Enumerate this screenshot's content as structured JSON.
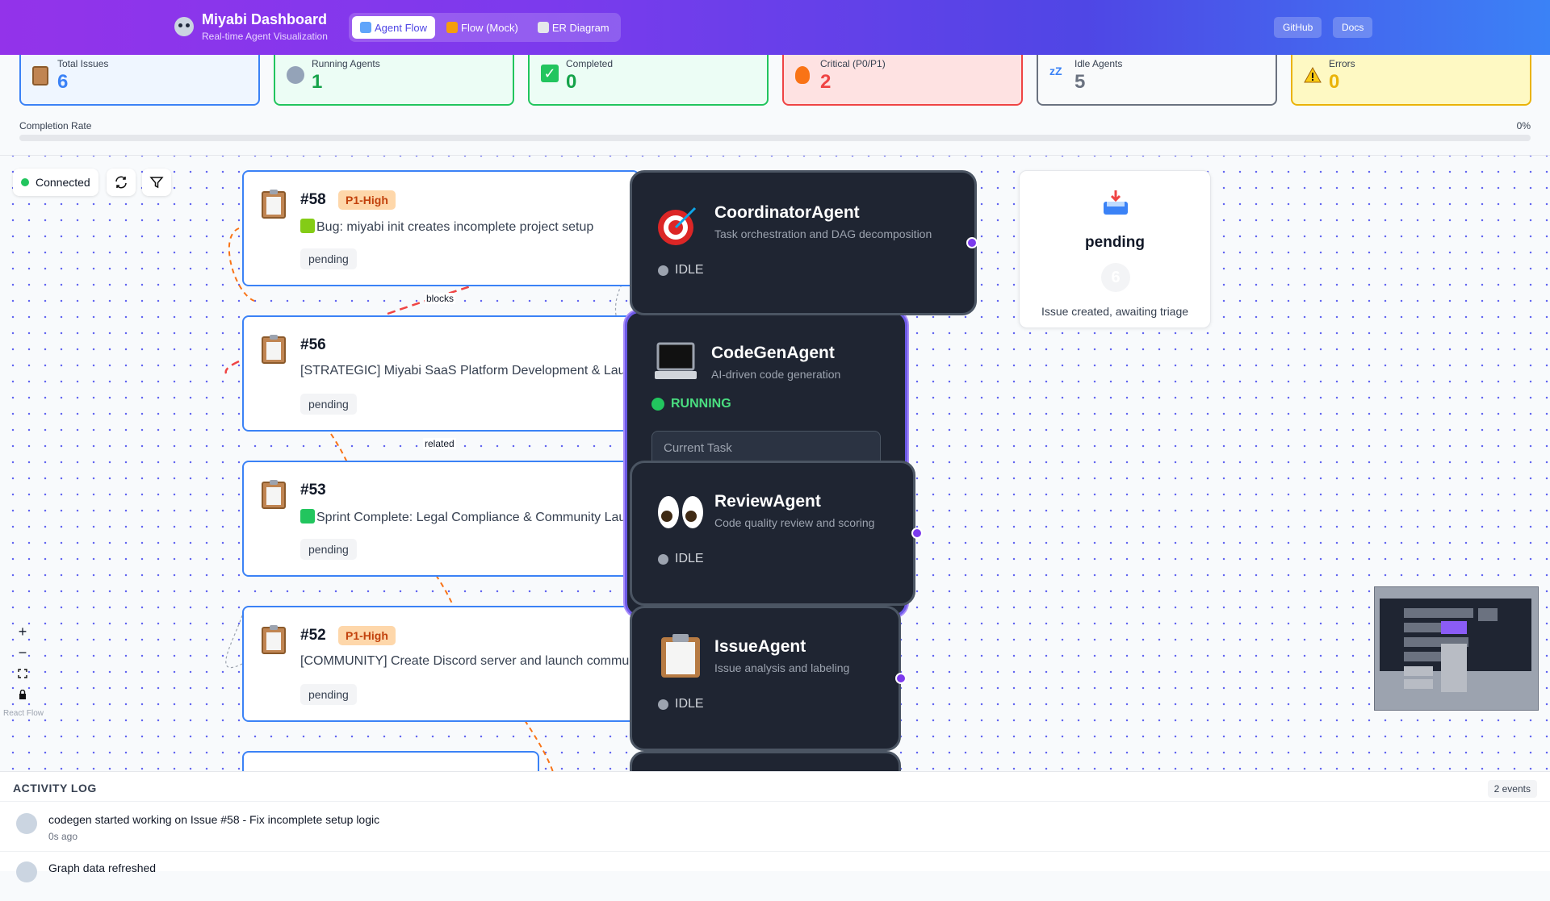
{
  "header": {
    "title": "Miyabi Dashboard",
    "subtitle": "Real-time Agent Visualization",
    "tabs": [
      {
        "label": "Agent Flow",
        "active": true
      },
      {
        "label": "Flow (Mock)",
        "active": false
      },
      {
        "label": "ER Diagram",
        "active": false
      }
    ],
    "github_label": "GitHub",
    "docs_label": "Docs"
  },
  "stats": [
    {
      "label": "Total Issues",
      "value": "6",
      "icon": "clipboard-icon",
      "color": "#3b82f6"
    },
    {
      "label": "Running Agents",
      "value": "1",
      "icon": "robot-icon",
      "color": "#22c55e"
    },
    {
      "label": "Completed",
      "value": "0",
      "icon": "check-icon",
      "color": "#22c55e"
    },
    {
      "label": "Critical (P0/P1)",
      "value": "2",
      "icon": "fire-icon",
      "color": "#ef4444"
    },
    {
      "label": "Idle Agents",
      "value": "5",
      "icon": "zzz-icon",
      "color": "#6b7280"
    },
    {
      "label": "Errors",
      "value": "0",
      "icon": "warning-icon",
      "color": "#eab308"
    }
  ],
  "completion": {
    "label": "Completion Rate",
    "percent_text": "0%",
    "value": 0
  },
  "canvas": {
    "connection_status": "Connected",
    "issues": [
      {
        "number": "#58",
        "priority": "P1-High",
        "title": "Bug: miyabi init creates incomplete project setup",
        "status": "pending"
      },
      {
        "number": "#56",
        "priority": "",
        "title": "[STRATEGIC] Miyabi SaaS Platform Development & Launch",
        "status": "pending"
      },
      {
        "number": "#53",
        "priority": "",
        "title": "Sprint Complete: Legal Compliance & Community Launch",
        "status": "pending"
      },
      {
        "number": "#52",
        "priority": "P1-High",
        "title": "[COMMUNITY] Create Discord server and launch community",
        "status": "pending"
      }
    ],
    "edge_labels": [
      "blocks",
      "related"
    ],
    "agents": [
      {
        "name": "CoordinatorAgent",
        "desc": "Task orchestration and DAG decomposition",
        "status": "IDLE",
        "icon": "target-icon"
      },
      {
        "name": "CodeGenAgent",
        "desc": "AI-driven code generation",
        "status": "RUNNING",
        "icon": "laptop-icon",
        "current_task_label": "Current Task"
      },
      {
        "name": "ReviewAgent",
        "desc": "Code quality review and scoring",
        "status": "IDLE",
        "icon": "eyes-icon"
      },
      {
        "name": "IssueAgent",
        "desc": "Issue analysis and labeling",
        "status": "IDLE",
        "icon": "clipboard-icon"
      }
    ],
    "state_node": {
      "title": "pending",
      "count": "6",
      "desc": "Issue created, awaiting triage",
      "icon": "inbox-icon"
    },
    "attribution": "React Flow",
    "zoom_controls": [
      "+",
      "−"
    ]
  },
  "activity": {
    "heading": "ACTIVITY LOG",
    "count_label": "2 events",
    "events": [
      {
        "message": "codegen started working on Issue #58 - Fix incomplete setup logic",
        "time": "0s ago"
      },
      {
        "message": "Graph data refreshed",
        "time": ""
      }
    ]
  }
}
